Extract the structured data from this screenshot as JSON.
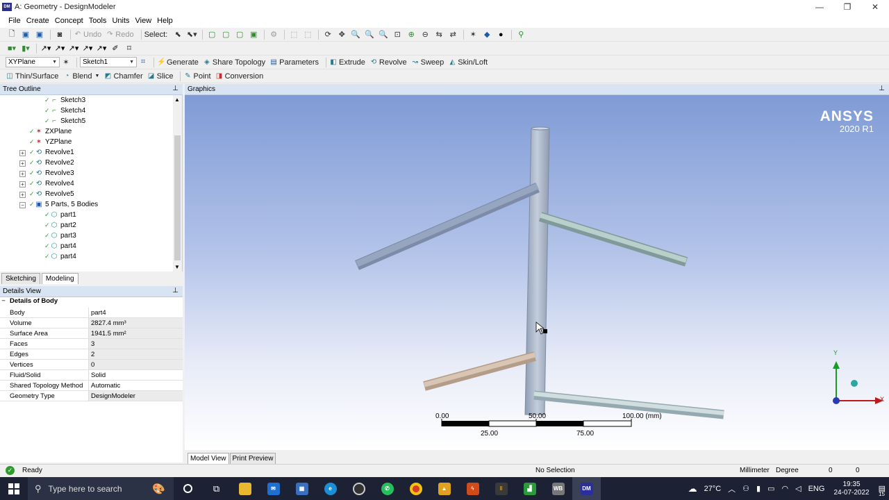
{
  "window": {
    "title": "A: Geometry - DesignModeler",
    "app_icon": "DM",
    "minimize": "—",
    "maximize": "❐",
    "close": "✕"
  },
  "menu": [
    "File",
    "Create",
    "Concept",
    "Tools",
    "Units",
    "View",
    "Help"
  ],
  "toolbar1": {
    "undo": "Undo",
    "redo": "Redo",
    "select_label": "Select:"
  },
  "toolbar3": {
    "plane_combo": "XYPlane",
    "sketch_combo": "Sketch1",
    "generate": "Generate",
    "share_topology": "Share Topology",
    "parameters": "Parameters",
    "extrude": "Extrude",
    "revolve": "Revolve",
    "sweep": "Sweep",
    "skin_loft": "Skin/Loft"
  },
  "toolbar4": {
    "thin_surface": "Thin/Surface",
    "blend": "Blend",
    "chamfer": "Chamfer",
    "slice": "Slice",
    "point": "Point",
    "conversion": "Conversion"
  },
  "tree_outline": {
    "title": "Tree Outline",
    "items": [
      {
        "label": "Sketch3",
        "icon": "sketch-icon"
      },
      {
        "label": "Sketch4",
        "icon": "sketch-icon"
      },
      {
        "label": "Sketch5",
        "icon": "sketch-icon"
      },
      {
        "label": "ZXPlane",
        "icon": "plane-icon"
      },
      {
        "label": "YZPlane",
        "icon": "plane-icon"
      },
      {
        "label": "Revolve1",
        "icon": "revolve-icon"
      },
      {
        "label": "Revolve2",
        "icon": "revolve-icon"
      },
      {
        "label": "Revolve3",
        "icon": "revolve-icon"
      },
      {
        "label": "Revolve4",
        "icon": "revolve-icon"
      },
      {
        "label": "Revolve5",
        "icon": "revolve-icon"
      },
      {
        "label": "5 Parts, 5 Bodies",
        "icon": "parts-icon"
      },
      {
        "label": "part1",
        "icon": "body-icon"
      },
      {
        "label": "part2",
        "icon": "body-icon"
      },
      {
        "label": "part3",
        "icon": "body-icon"
      },
      {
        "label": "part4",
        "icon": "body-icon"
      },
      {
        "label": "part4",
        "icon": "body-icon"
      }
    ]
  },
  "panel_tabs": {
    "sketching": "Sketching",
    "modeling": "Modeling"
  },
  "details_view": {
    "title": "Details View",
    "section": "Details of Body",
    "rows": [
      {
        "key": "Body",
        "value": "part4"
      },
      {
        "key": "Volume",
        "value": "2827.4 mm³"
      },
      {
        "key": "Surface Area",
        "value": "1941.5 mm²"
      },
      {
        "key": "Faces",
        "value": "3"
      },
      {
        "key": "Edges",
        "value": "2"
      },
      {
        "key": "Vertices",
        "value": "0"
      },
      {
        "key": "Fluid/Solid",
        "value": "Solid"
      },
      {
        "key": "Shared Topology Method",
        "value": "Automatic"
      },
      {
        "key": "Geometry Type",
        "value": "DesignModeler"
      }
    ]
  },
  "graphics": {
    "title": "Graphics",
    "logo": "ANSYS",
    "version": "2020 R1",
    "scale_top": [
      "0.00",
      "50.00",
      "100.00 (mm)"
    ],
    "scale_bottom": [
      "25.00",
      "75.00"
    ],
    "triad": {
      "y": "Y",
      "x": "X"
    },
    "tabs": [
      "Model View",
      "Print Preview"
    ]
  },
  "status": {
    "ready": "Ready",
    "selection": "No Selection",
    "unit_length": "Millimeter",
    "unit_angle": "Degree",
    "val1": "0",
    "val2": "0"
  },
  "taskbar": {
    "search_placeholder": "Type here to search",
    "weather": "27°C",
    "lang": "ENG",
    "time": "19:35",
    "date": "24-07-2022",
    "notif_count": "15"
  }
}
